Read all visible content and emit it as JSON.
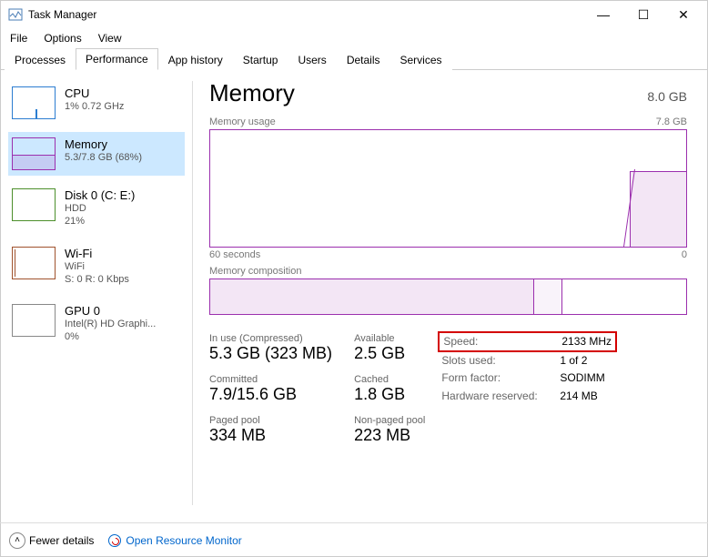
{
  "window": {
    "title": "Task Manager"
  },
  "menu": {
    "file": "File",
    "options": "Options",
    "view": "View"
  },
  "tabs": {
    "processes": "Processes",
    "performance": "Performance",
    "app_history": "App history",
    "startup": "Startup",
    "users": "Users",
    "details": "Details",
    "services": "Services"
  },
  "sidebar": {
    "cpu": {
      "name": "CPU",
      "sub": "1% 0.72 GHz"
    },
    "memory": {
      "name": "Memory",
      "sub": "5.3/7.8 GB (68%)"
    },
    "disk": {
      "name": "Disk 0 (C: E:)",
      "type": "HDD",
      "pct": "21%"
    },
    "wifi": {
      "name": "Wi-Fi",
      "type": "WiFi",
      "rate": "S: 0 R: 0 Kbps"
    },
    "gpu": {
      "name": "GPU 0",
      "type": "Intel(R) HD Graphi...",
      "pct": "0%"
    }
  },
  "main": {
    "title": "Memory",
    "capacity": "8.0 GB",
    "usage_label": "Memory usage",
    "usage_max": "7.8 GB",
    "axis_left": "60 seconds",
    "axis_right": "0",
    "comp_label": "Memory composition",
    "stats": {
      "inuse_label": "In use (Compressed)",
      "inuse": "5.3 GB (323 MB)",
      "available_label": "Available",
      "available": "2.5 GB",
      "committed_label": "Committed",
      "committed": "7.9/15.6 GB",
      "cached_label": "Cached",
      "cached": "1.8 GB",
      "paged_label": "Paged pool",
      "paged": "334 MB",
      "nonpaged_label": "Non-paged pool",
      "nonpaged": "223 MB"
    },
    "hw": {
      "speed_k": "Speed:",
      "speed_v": "2133 MHz",
      "slots_k": "Slots used:",
      "slots_v": "1 of 2",
      "form_k": "Form factor:",
      "form_v": "SODIMM",
      "reserved_k": "Hardware reserved:",
      "reserved_v": "214 MB"
    }
  },
  "footer": {
    "fewer": "Fewer details",
    "monitor": "Open Resource Monitor"
  },
  "chart_data": {
    "type": "area",
    "title": "Memory usage",
    "ylabel": "GB",
    "ylim": [
      0,
      7.8
    ],
    "x_span_seconds": 60,
    "series": [
      {
        "name": "Memory",
        "snapshot_value_gb": 5.3,
        "recent_step_visible": true
      }
    ]
  }
}
